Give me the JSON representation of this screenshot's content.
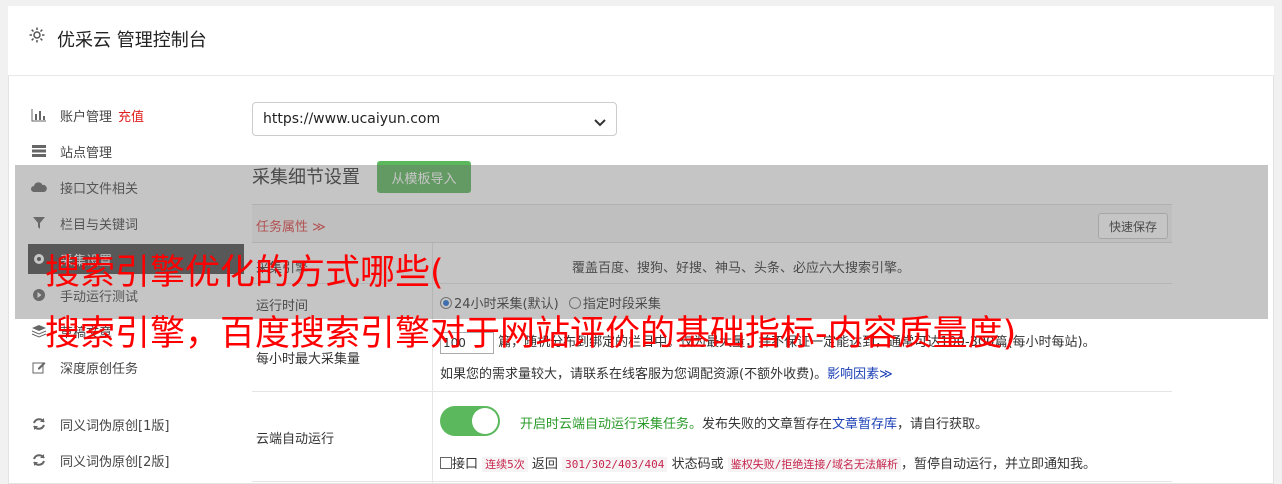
{
  "header": {
    "title": "优采云 管理控制台"
  },
  "sidebar": {
    "items": [
      {
        "label": "账户管理",
        "extra": "充值"
      },
      {
        "label": "站点管理"
      },
      {
        "label": "接口文件相关"
      },
      {
        "label": "栏目与关键词"
      },
      {
        "label": "采集设置"
      },
      {
        "label": "手动运行测试"
      },
      {
        "label": "草稿文章"
      },
      {
        "label": "深度原创任务"
      },
      {
        "label": "同义词伪原创[1版]"
      },
      {
        "label": "同义词伪原创[2版]"
      }
    ]
  },
  "site_select": {
    "value": "https://www.ucaiyun.com"
  },
  "section": {
    "title": "采集细节设置",
    "import_button": "从模板导入"
  },
  "table": {
    "head_label": "任务属性 ≫",
    "quick_save": "快速保存",
    "rows": {
      "engine": {
        "label": "采集引擎",
        "text": "覆盖百度、搜狗、好搜、神马、头条、必应六大搜索引擎。"
      },
      "runtime": {
        "label": "运行时间",
        "opt1": "24小时采集(默认)",
        "opt2": "指定时段采集"
      },
      "maxcount": {
        "label": "每小时最大采集量",
        "input": "100",
        "line1": "篇，随机分布到绑定的栏目中。仅为最大量，并不保证一定能达到，通常可达100-300篇(每小时每站)。",
        "line2_prefix": "如果您的需求量较大，请联系在线客服为您调配资源(不额外收费)。",
        "line2_link": "影响因素≫"
      },
      "cloud": {
        "label": "云端自动运行",
        "line1_green": "开启时云端自动运行采集任务。",
        "line1_mid": "发布失败的文章暂存在",
        "line1_link": "文章暂存库",
        "line1_end": "，请自行获取。",
        "line2_a": "接口",
        "line2_code1": "连续5次",
        "line2_b": "返回",
        "line2_code2": "301/302/403/404",
        "line2_c": "状态码或",
        "line2_code3": "鉴权失败/拒绝连接/域名无法解析",
        "line2_d": "，暂停自动运行，并立即通知我。"
      }
    }
  },
  "overlay": {
    "line1": "搜索引擎优化的方式哪些(",
    "line2": "搜索引擎，百度搜索引擎对于网站评价的基础指标-内容质量度)"
  }
}
